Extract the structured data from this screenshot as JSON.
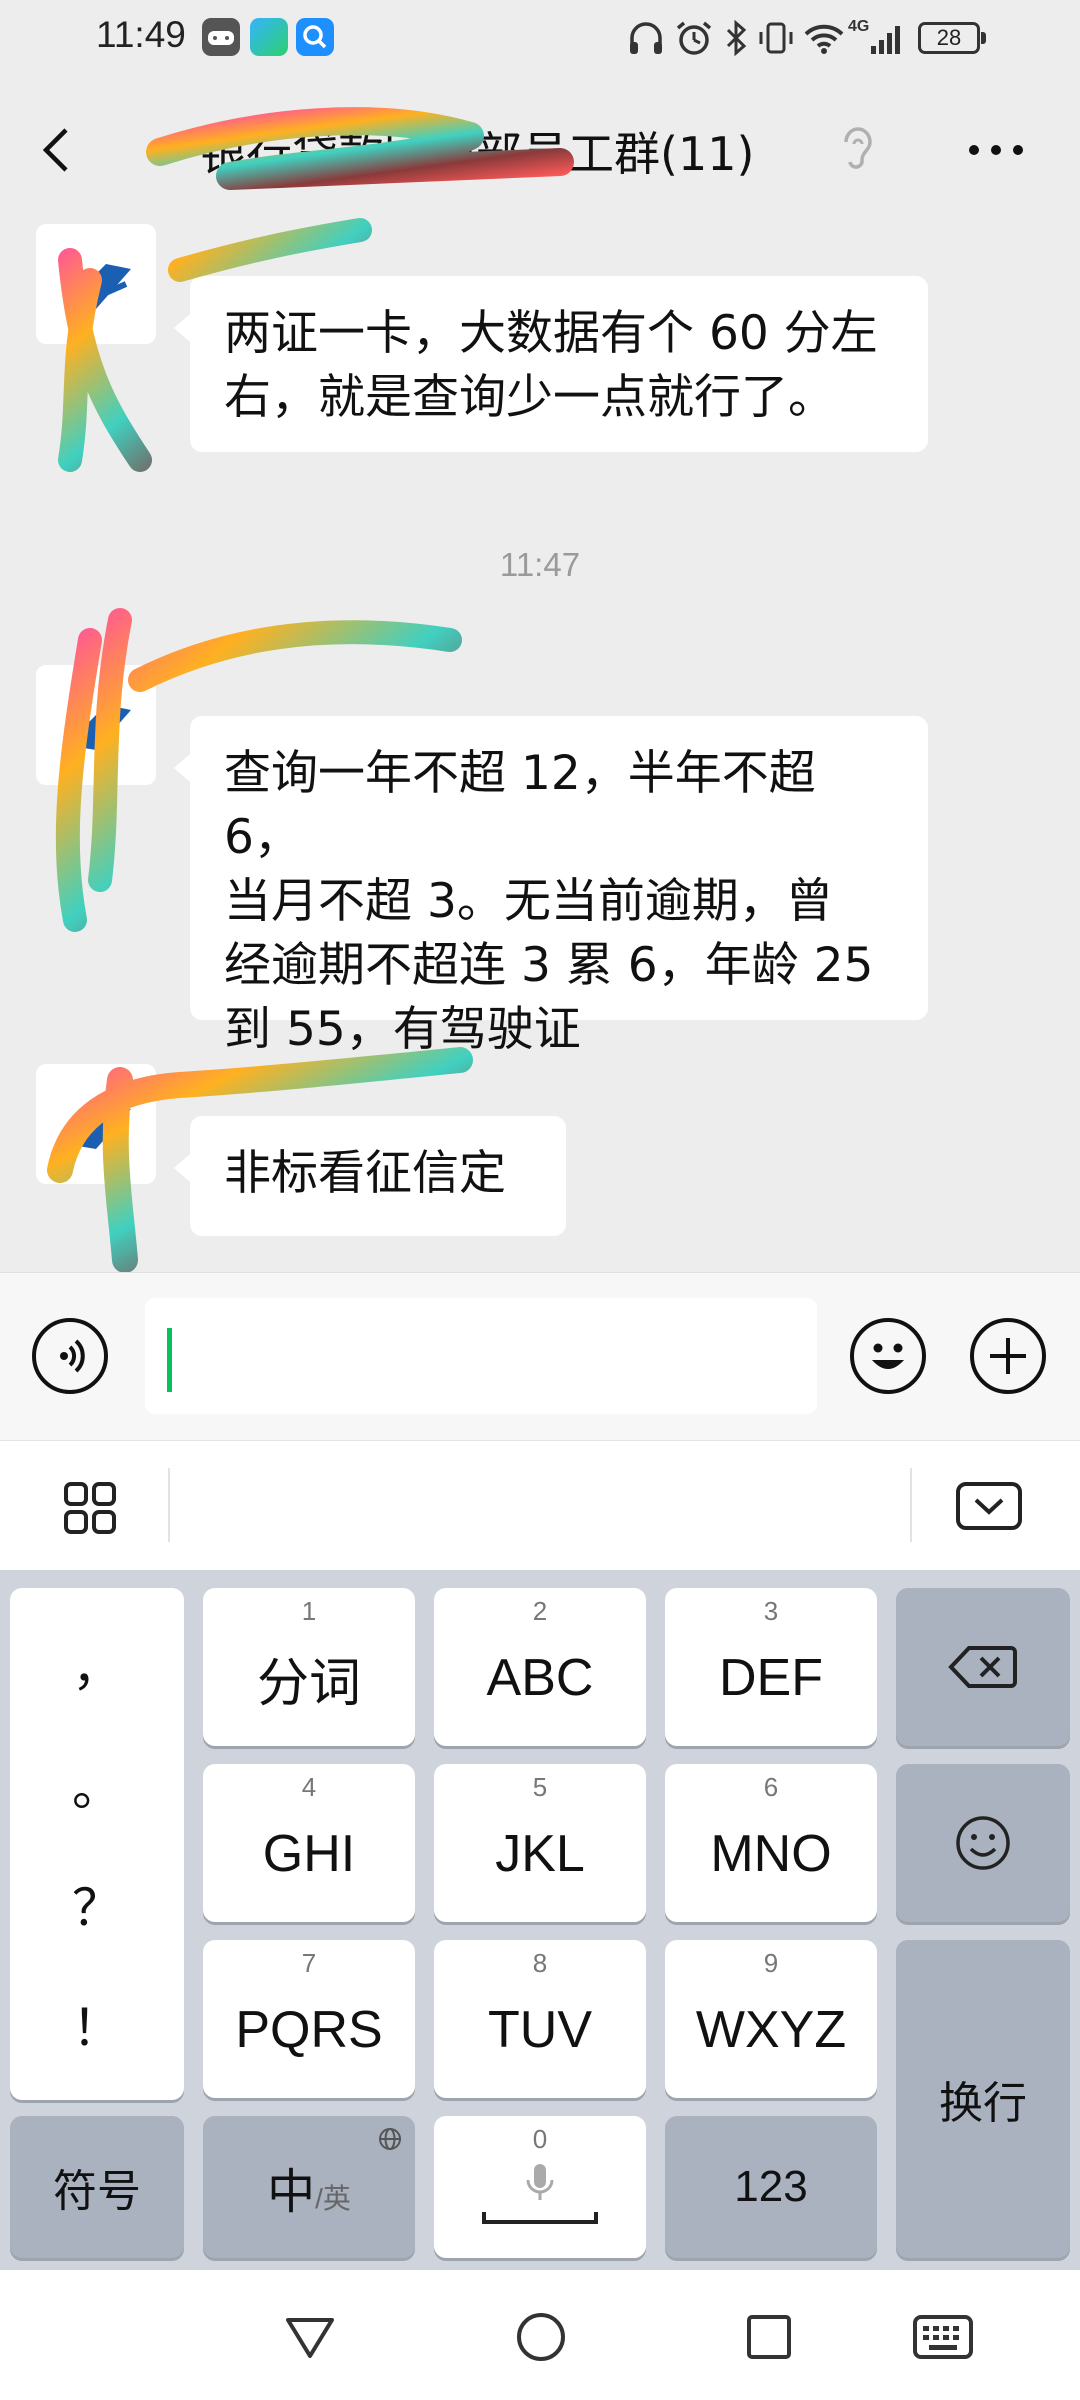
{
  "status_bar": {
    "time": "11:49",
    "network": "4G",
    "battery": "28",
    "icons": [
      "game-controller-icon",
      "app-icon",
      "search-app-icon",
      "headphones-icon",
      "alarm-icon",
      "bluetooth-icon",
      "vibrate-icon",
      "wifi-icon",
      "signal-icon"
    ]
  },
  "header": {
    "back_icon": "chevron-left-icon",
    "title": "银行贷款团内部员工群(11)",
    "title_visible_suffix": "团内部员工群(11)",
    "ear_icon": "ear-icon",
    "more_icon": "more-dots-icon"
  },
  "chat": {
    "timestamp": "11:47",
    "messages": [
      {
        "sender": "",
        "text_lines": [
          "两证一卡，大数据有个 60 分左",
          "右，就是查询少一点就行了。"
        ]
      },
      {
        "sender": "",
        "text_lines": [
          "查询一年不超 12，半年不超 6，",
          "当月不超 3。无当前逾期，曾",
          "经逾期不超连 3 累 6，年龄 25",
          "到 55，有驾驶证"
        ]
      },
      {
        "sender": "",
        "text_lines": [
          "非标看征信定"
        ]
      }
    ]
  },
  "input_bar": {
    "voice_icon": "voice-icon",
    "input_value": "",
    "emoji_icon": "emoji-icon",
    "plus_icon": "plus-icon"
  },
  "keyboard": {
    "toolbar": {
      "grid_icon": "grid-icon",
      "collapse_icon": "keyboard-collapse-icon"
    },
    "punctuation": [
      "，",
      "。",
      "？",
      "！"
    ],
    "keys": [
      {
        "num": "1",
        "label": "分词"
      },
      {
        "num": "2",
        "label": "ABC"
      },
      {
        "num": "3",
        "label": "DEF"
      },
      {
        "num": "4",
        "label": "GHI"
      },
      {
        "num": "5",
        "label": "JKL"
      },
      {
        "num": "6",
        "label": "MNO"
      },
      {
        "num": "7",
        "label": "PQRS"
      },
      {
        "num": "8",
        "label": "TUV"
      },
      {
        "num": "9",
        "label": "WXYZ"
      }
    ],
    "backspace_icon": "backspace-icon",
    "smiley_icon": "smiley-icon",
    "enter_label": "换行",
    "symbol_label": "符号",
    "lang_main": "中",
    "lang_sub": "/英",
    "space_num": "0",
    "num_label": "123"
  },
  "nav_bar": {
    "icons": [
      "back-triangle-icon",
      "home-circle-icon",
      "recents-square-icon",
      "keyboard-icon"
    ]
  },
  "colors": {
    "background": "#ededed",
    "bubble": "#ffffff",
    "cursor_green": "#07c160",
    "key_dark": "#aab2c0",
    "keyboard_bg": "#cfd3db"
  }
}
